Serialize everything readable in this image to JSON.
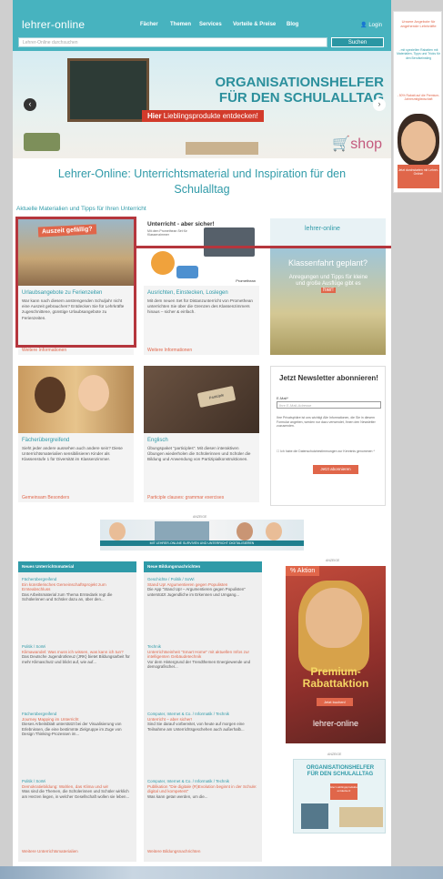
{
  "header": {
    "logo": "lehrer-online",
    "nav": [
      "Fächer",
      "Themen",
      "Services",
      "Vorteile & Preise",
      "Blog"
    ],
    "login": "Login",
    "search_placeholder": "Lehrer-Online durchsuchen",
    "search_button": "Suchen"
  },
  "hero": {
    "line1": "ORGANISATIONSHELFER",
    "line2": "FÜR DEN SCHULALLTAG",
    "tag_prefix": "Hier",
    "tag_text": "Lieblingsprodukte entdecken!",
    "shop": "shop"
  },
  "page_title": "Lehrer-Online: Unterrichtsmaterial und Inspiration für den Schulalltag",
  "section_title": "Aktuelle Materialien und Tipps für Ihren Unterricht",
  "cards": [
    {
      "img_text": "Auszeit gefällig?",
      "title": "Urlaubsangebote zu Ferienzeiten",
      "desc": "War kann nach diesem anstrengenden Schuljahr nicht eine Auszeit gebrauchen? Entdecken Sie für Lehrkräfte zugeschnittene, günstige Urlaubsangebote zu Ferienzeiten.",
      "link": "Weitere Informationen"
    },
    {
      "img_text": "Unterricht - aber sicher!",
      "img_sub": "Mit dem Promethean Set für Klassenzimmer",
      "brand": "Promethean",
      "title": "Ausrichten, Einstecken, Loslegen",
      "desc": "Mit dem neuen Set für Distanzunterricht von Promethean unterrichten Sie über die Grenzen des Klassenzimmers hinaus – sicher & einfach.",
      "link": "Weitere Informationen"
    },
    {
      "logo": "lehrer-online",
      "img_text": "Klassenfahrt geplant?",
      "img_sub": "Anregungen und Tipps für kleine und große Ausflüge gibt es",
      "img_link": "hier!"
    },
    {
      "title": "Fächerübergreifend",
      "desc": "Sieht jeder andere aussehen auch andere sein? Diese Unterrichtsmaterialien sensibilisieren Kinder als Klassenstufe 1 für Diversität im Klassenzimmer.",
      "link": "Gemeinsam Besonders"
    },
    {
      "img_text": "Participle",
      "title": "Englisch",
      "desc": "Übungspaket \"participles\": Mit diesen interaktiven Übungen wiederholen die Schülerinnen und Schüler die Bildung und Anwendung von Partizipialkonstruktionen.",
      "link": "Participle clauses: grammar exercises"
    }
  ],
  "newsletter": {
    "title": "Jetzt Newsletter abonnieren!",
    "label": "E-Mail*",
    "placeholder": "Ihre E-Mail-Adresse",
    "text": "Ihre Privatsphäre ist uns wichtig! Alle Informationen, die Sie in diesem Formular angeben, werden nur dazu verwendet, Ihnen den Newsletter zuzusenden.",
    "checkbox": "Ich habe die Datenschutzbestimmungen zur Kenntnis genommen *",
    "button": "Jetzt abonnieren"
  },
  "banner": {
    "label": "ANZEIGE",
    "strip": "MIT LEHRER-ONLINE SURVIVEN UND UNTERRICHT DIGITALISIEREN"
  },
  "unterricht": {
    "header": "Neues Unterrichtsmaterial",
    "items": [
      {
        "cat": "Fächerübergreifend",
        "title": "Ein künstlerisches Gemeinschaftsprojekt zum Ernteabschluss",
        "desc": "Das Arbeitsmaterial zum Thema Erntedank regt die Schülerinnen und Schüler dazu an, über den..."
      },
      {
        "cat": "Politik / SoWi",
        "title": "Klimawandel: Was muss ich wissen, was kann ich tun?",
        "desc": "Das Deutsche Jugendrotkreuz (JRK) bietet Bildungsarbeit für mehr Klimaschutz und blickt auf, wie auf..."
      },
      {
        "cat": "Fächerübergreifend",
        "title": "Journey Mapping im Unterricht",
        "desc": "Dieses Arbeitsblatt unterstützt bei der Visualisierung von Erlebnissen, die eine bestimmte Zielgruppe im Zuge von Design Thinking-Prozessen im..."
      },
      {
        "cat": "Politik / SoWi",
        "title": "Demokratiebildung: Wahlen, das Klima und wir",
        "desc": "Was sind die Themen, die Schülerinnen und Schüler wirklich am Herzen liegen, in welcher Gesellschaft wollen sie leben..."
      }
    ],
    "more": "Weitere Unterrichtsmaterialien"
  },
  "bildung": {
    "header": "Neue Bildungsnachrichten",
    "items": [
      {
        "cat": "Geschichte / Politik / SoWi",
        "title": "Stand Up! Argumentieren gegen Populisten",
        "desc": "Die App \"Stand Up! – Argumentieren gegen Populisten\" unterstützt Jugendliche im Erkennen und Umgang..."
      },
      {
        "cat": "Technik",
        "title": "Unterrichtseinheit \"Smart Home\" mit aktuellen Infos zur intelligenten Gebäudetechnik",
        "desc": "Vor dem Hintergrund der Trendthemen Energiewende und demografischer..."
      },
      {
        "cat": "Computer, Internet & Co. / Informatik / Technik",
        "title": "Unterricht – aber sicher!",
        "desc": "Sind Sie darauf vorbereitet, von heute auf morgen eine Teilnahme am Unterrichtsgeschehen auch außerhalb..."
      },
      {
        "cat": "Computer, Internet & Co. / Informatik / Technik",
        "title": "Publikation \"Die digitale (R)Evolution beginnt in der Schule: digital und kompetent\"",
        "desc": "Was kann getan werden, um die..."
      }
    ],
    "more": "Weitere Bildungsnachrichten"
  },
  "ad_promo": {
    "label": "ANZEIGE",
    "tag": "% Aktion",
    "title": "Premium-Rabattaktion",
    "button": "Jetzt buchen!",
    "logo": "lehrer-online"
  },
  "ad_org": {
    "label": "ANZEIGE",
    "line1": "ORGANISATIONSHELFER",
    "line2": "FÜR DEN SCHULALLTAG",
    "badge": "Hier Lieblingsprodukte entdecken!"
  },
  "side_ad": {
    "title": "Unsere Angebote für angehende Lehrkräfte",
    "text": "- mit speziellen Rabatten mit Materialien, Tipps und Tricks für den Berufseinstieg",
    "text2": "- 50% Rabatt auf die Premium-Jahresmitgliedschaft",
    "box": "Jetzt durchstarten mit Lehrer-Online!"
  }
}
